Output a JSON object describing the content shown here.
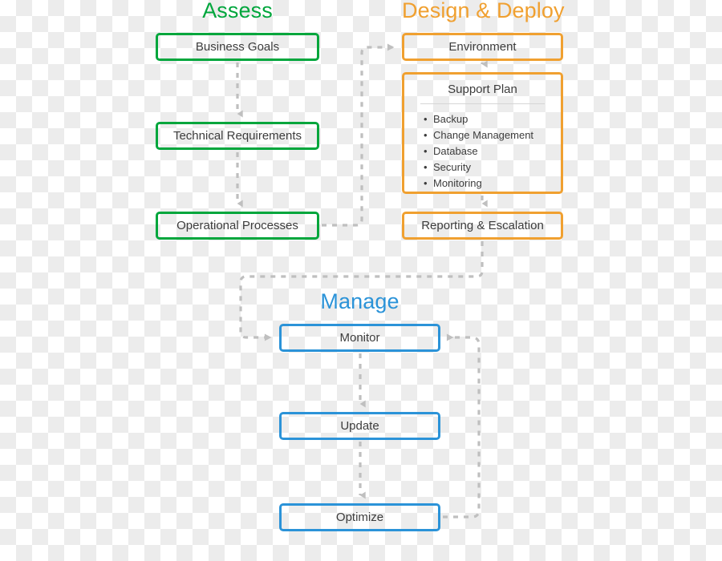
{
  "diagram": {
    "title": "Assess, Design & Deploy, Manage lifecycle flow",
    "colors": {
      "assess_green": "#00A63C",
      "design_orange": "#F0A030",
      "manage_blue": "#2B93D8",
      "connector_gray": "#BFBFBF",
      "text_gray": "#3C3C3C"
    }
  },
  "sections": {
    "assess": {
      "title": "Assess",
      "nodes": [
        {
          "label": "Business Goals"
        },
        {
          "label": "Technical Requirements"
        },
        {
          "label": "Operational Processes"
        }
      ]
    },
    "design_deploy": {
      "title": "Design & Deploy",
      "nodes": [
        {
          "label": "Environment"
        },
        {
          "label": "Reporting & Escalation"
        }
      ],
      "support_plan": {
        "title": "Support Plan",
        "items": [
          "Backup",
          "Change Management",
          "Database",
          "Security",
          "Monitoring"
        ]
      }
    },
    "manage": {
      "title": "Manage",
      "nodes": [
        {
          "label": "Monitor"
        },
        {
          "label": "Update"
        },
        {
          "label": "Optimize"
        }
      ]
    }
  }
}
